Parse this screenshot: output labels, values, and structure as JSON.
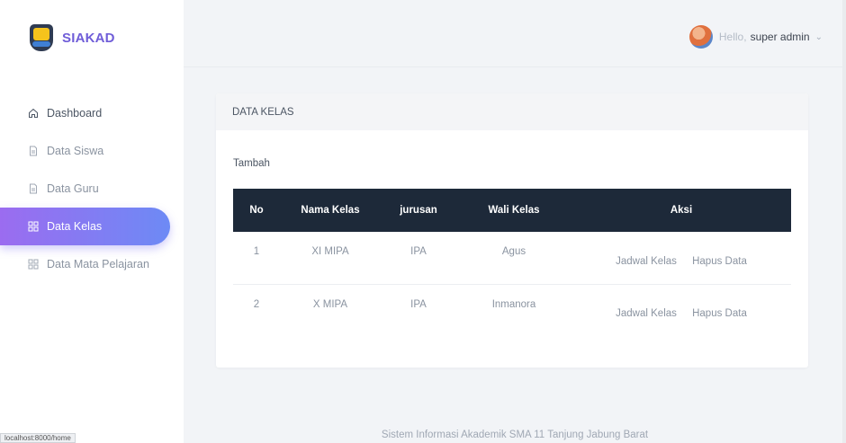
{
  "brand": {
    "name": "SIAKAD"
  },
  "sidebar": {
    "items": [
      {
        "label": "Dashboard",
        "icon": "home-icon"
      },
      {
        "label": "Data Siswa",
        "icon": "document-icon"
      },
      {
        "label": "Data Guru",
        "icon": "document-icon"
      },
      {
        "label": "Data Kelas",
        "icon": "grid-icon",
        "active": true
      },
      {
        "label": "Data Mata Pelajaran",
        "icon": "grid-icon"
      }
    ]
  },
  "topbar": {
    "greeting": "Hello,",
    "username": "super admin",
    "caret_icon": "chevron-down-icon"
  },
  "card": {
    "title": "DATA KELAS",
    "add_label": "Tambah",
    "table": {
      "headers": [
        "No",
        "Nama Kelas",
        "jurusan",
        "Wali Kelas",
        "Aksi"
      ],
      "rows": [
        {
          "no": "1",
          "nama_kelas": "XI MIPA",
          "jurusan": "IPA",
          "wali_kelas": "Agus",
          "aksi_jadwal": "Jadwal Kelas",
          "aksi_hapus": "Hapus Data"
        },
        {
          "no": "2",
          "nama_kelas": "X MIPA",
          "jurusan": "IPA",
          "wali_kelas": "Inmanora",
          "aksi_jadwal": "Jadwal Kelas",
          "aksi_hapus": "Hapus Data"
        }
      ]
    }
  },
  "footer": {
    "text": "Sistem Informasi Akademik SMA 11 Tanjung Jabung Barat"
  },
  "statusbar": {
    "url": "localhost:8000/home"
  },
  "colors": {
    "brand": "#6f5dd8",
    "active_gradient_start": "#9b6cf0",
    "active_gradient_end": "#6d8af5",
    "table_header": "#1d2939"
  }
}
